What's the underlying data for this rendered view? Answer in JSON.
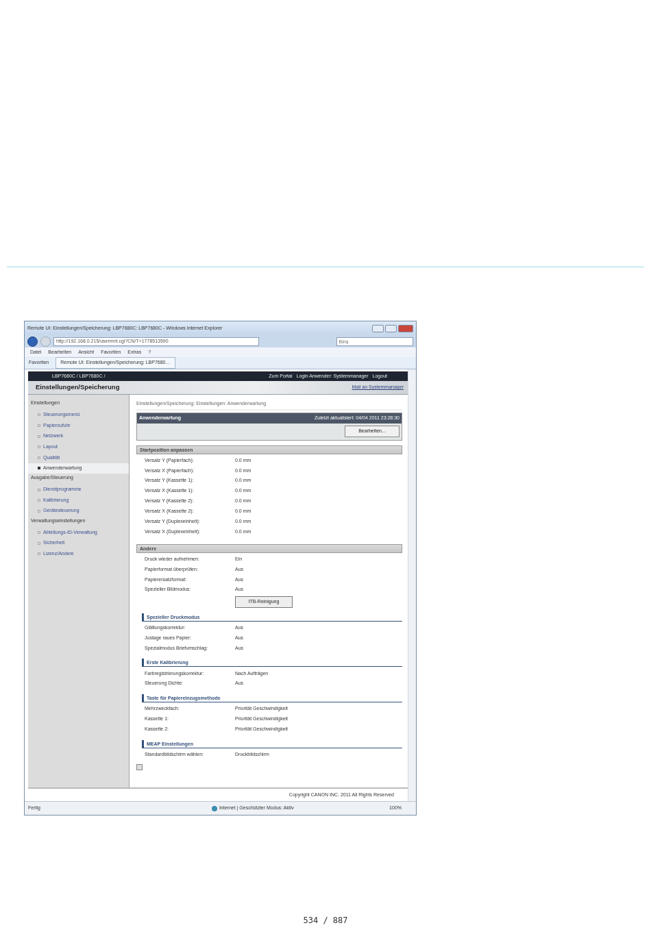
{
  "browser": {
    "title": "Remote UI: Einstellungen/Speicherung: LBP7680C: LBP7680C - Windows Internet Explorer",
    "address": "http://192.168.0.215/usermnt.cgi?CN/T=1778513590",
    "search_placeholder": "Bing",
    "menu": [
      "Datei",
      "Bearbeiten",
      "Ansicht",
      "Favoriten",
      "Extras",
      "?"
    ],
    "favorites": "Favoriten",
    "tab": "Remote UI: Einstellungen/Speicherung: LBP7680...",
    "status": {
      "left": "Fertig",
      "zone": "Internet | Geschützter Modus: Aktiv",
      "zoom": "100%"
    }
  },
  "header": {
    "device": "LBP7680C / LBP7680C /",
    "links": [
      "Zum Portal",
      "Login Anwender: Systemmanager",
      "Logout"
    ],
    "title": "Einstellungen/Speicherung",
    "mail": "Mail an Systemmanager"
  },
  "sidebar": [
    {
      "label": "Einstellungen",
      "children": [
        {
          "label": "Steuerungsmenü",
          "selected": false
        },
        {
          "label": "Papierzufuhr",
          "selected": false
        },
        {
          "label": "Netzwerk",
          "selected": false
        },
        {
          "label": "Layout",
          "selected": false
        },
        {
          "label": "Qualität",
          "selected": false
        },
        {
          "label": "Anwenderwartung",
          "selected": true
        }
      ]
    },
    {
      "label": "Ausgabe/Steuerung",
      "children": [
        {
          "label": "Dienstprogramme",
          "selected": false
        },
        {
          "label": "Kalibrierung",
          "selected": false
        },
        {
          "label": "Gerätesteuerung",
          "selected": false
        }
      ]
    },
    {
      "label": "Verwaltungseinstellungen",
      "children": [
        {
          "label": "Abteilungs-ID-Verwaltung",
          "selected": false
        },
        {
          "label": "Sicherheit",
          "selected": false
        },
        {
          "label": "Lizenz/Andere",
          "selected": false
        }
      ]
    }
  ],
  "breadcrumb": "Einstellungen/Speicherung: Einstellungen: Anwenderwartung",
  "panel": {
    "title": "Anwenderwartung",
    "updated": "Zuletzt aktualisiert: 04/04 2011 23:28:30",
    "button": "Bearbeiten..."
  },
  "sections": [
    {
      "kind": "bar",
      "title": "Startposition anpassen",
      "rows": [
        {
          "label": "Versatz Y (Papierfach):",
          "value": "0.0 mm"
        },
        {
          "label": "Versatz X (Papierfach):",
          "value": "0.0 mm"
        },
        {
          "label": "Versatz Y (Kassette 1):",
          "value": "0.0 mm"
        },
        {
          "label": "Versatz X (Kassette 1):",
          "value": "0.0 mm"
        },
        {
          "label": "Versatz Y (Kassette 2):",
          "value": "0.0 mm"
        },
        {
          "label": "Versatz X (Kassette 2):",
          "value": "0.0 mm"
        },
        {
          "label": "Versatz Y (Duplexeinheit):",
          "value": "0.0 mm"
        },
        {
          "label": "Versatz X (Duplexeinheit):",
          "value": "0.0 mm"
        }
      ]
    },
    {
      "kind": "bar",
      "title": "Andere",
      "button": "ITB-Reinigung",
      "rows": [
        {
          "label": "Druck wieder aufnehmen:",
          "value": "Ein"
        },
        {
          "label": "Papierformat überprüfen:",
          "value": "Aus"
        },
        {
          "label": "Papierersatzformat:",
          "value": "Aus"
        },
        {
          "label": "Spezieller Bildmodus:",
          "value": "Aus"
        }
      ]
    },
    {
      "kind": "rule",
      "title": "Spezieller Druckmodus",
      "rows": [
        {
          "label": "Glättungskorrektur:",
          "value": "Aus"
        },
        {
          "label": "Justage raues Papier:",
          "value": "Aus"
        },
        {
          "label": "Spezialmodus Briefumschlag:",
          "value": "Aus"
        }
      ]
    },
    {
      "kind": "rule",
      "title": "Erste Kalibrierung",
      "rows": [
        {
          "label": "Farbregistrierungskorrektur:",
          "value": "Nach Aufträgen"
        },
        {
          "label": "Steuerung Dichte:",
          "value": "Aus"
        }
      ]
    },
    {
      "kind": "rule",
      "title": "Taste für Papiereinzugsmethode",
      "rows": [
        {
          "label": "Mehrzweckfach:",
          "value": "Priorität Geschwindigkeit"
        },
        {
          "label": "Kassette 1:",
          "value": "Priorität Geschwindigkeit"
        },
        {
          "label": "Kassette 2:",
          "value": "Priorität Geschwindigkeit"
        }
      ]
    },
    {
      "kind": "rule",
      "title": "MEAP Einstellungen",
      "rows": [
        {
          "label": "Standardbildschirm wählen:",
          "value": "Druckbildschirm"
        }
      ]
    }
  ],
  "copyright": "Copyright CANON INC. 2011 All Rights Reserved",
  "page_number": "534 / 887"
}
